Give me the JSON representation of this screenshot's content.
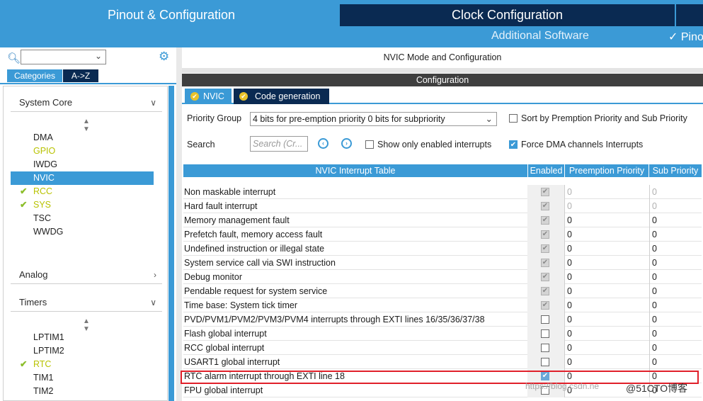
{
  "header": {
    "tab_pinout": "Pinout & Configuration",
    "tab_clock": "Clock Configuration",
    "additional_software": "Additional Software",
    "pinout_view": "✓ Pino"
  },
  "left": {
    "tab_categories": "Categories",
    "tab_az": "A->Z",
    "system_core": {
      "label": "System Core",
      "items": [
        {
          "label": "DMA",
          "state": "normal"
        },
        {
          "label": "GPIO",
          "state": "yellow"
        },
        {
          "label": "IWDG",
          "state": "normal"
        },
        {
          "label": "NVIC",
          "state": "selected"
        },
        {
          "label": "RCC",
          "state": "checked"
        },
        {
          "label": "SYS",
          "state": "checked"
        },
        {
          "label": "TSC",
          "state": "normal"
        },
        {
          "label": "WWDG",
          "state": "normal"
        }
      ]
    },
    "analog": {
      "label": "Analog"
    },
    "timers": {
      "label": "Timers",
      "items": [
        {
          "label": "LPTIM1",
          "state": "normal"
        },
        {
          "label": "LPTIM2",
          "state": "normal"
        },
        {
          "label": "RTC",
          "state": "checked"
        },
        {
          "label": "TIM1",
          "state": "normal"
        },
        {
          "label": "TIM2",
          "state": "normal"
        }
      ]
    }
  },
  "main": {
    "mode_title": "NVIC Mode and Configuration",
    "config_title": "Configuration",
    "tab_nvic": "NVIC",
    "tab_code_generation": "Code generation",
    "priority_group_label": "Priority Group",
    "priority_group_value": "4 bits for pre-emption priority 0 bits for subpriority",
    "sort_label": "Sort by Premption Priority and Sub Priority",
    "search_label": "Search",
    "search_placeholder": "Search (Cr...",
    "show_enabled_label": "Show only enabled interrupts",
    "force_dma_label": "Force DMA channels Interrupts",
    "force_dma_checked": true
  },
  "table": {
    "headers": [
      "NVIC Interrupt Table",
      "Enabled",
      "Preemption Priority",
      "Sub Priority"
    ],
    "rows": [
      {
        "name": "Non maskable interrupt",
        "enabled": "disabled-on",
        "pre": "0",
        "sub": "0",
        "grey": true
      },
      {
        "name": "Hard fault interrupt",
        "enabled": "disabled-on",
        "pre": "0",
        "sub": "0",
        "grey": true
      },
      {
        "name": "Memory management fault",
        "enabled": "disabled-on",
        "pre": "0",
        "sub": "0",
        "grey": false
      },
      {
        "name": "Prefetch fault, memory access fault",
        "enabled": "disabled-on",
        "pre": "0",
        "sub": "0",
        "grey": false
      },
      {
        "name": "Undefined instruction or illegal state",
        "enabled": "disabled-on",
        "pre": "0",
        "sub": "0",
        "grey": false
      },
      {
        "name": "System service call via SWI instruction",
        "enabled": "disabled-on",
        "pre": "0",
        "sub": "0",
        "grey": false
      },
      {
        "name": "Debug monitor",
        "enabled": "disabled-on",
        "pre": "0",
        "sub": "0",
        "grey": false
      },
      {
        "name": "Pendable request for system service",
        "enabled": "disabled-on",
        "pre": "0",
        "sub": "0",
        "grey": false
      },
      {
        "name": "Time base: System tick timer",
        "enabled": "disabled-on",
        "pre": "0",
        "sub": "0",
        "grey": false
      },
      {
        "name": "PVD/PVM1/PVM2/PVM3/PVM4 interrupts through EXTI lines 16/35/36/37/38",
        "enabled": "off",
        "pre": "0",
        "sub": "0",
        "grey": false
      },
      {
        "name": "Flash global interrupt",
        "enabled": "off",
        "pre": "0",
        "sub": "0",
        "grey": false
      },
      {
        "name": "RCC global interrupt",
        "enabled": "off",
        "pre": "0",
        "sub": "0",
        "grey": false
      },
      {
        "name": "USART1 global interrupt",
        "enabled": "off",
        "pre": "0",
        "sub": "0",
        "grey": false
      },
      {
        "name": "RTC alarm interrupt through EXTI line 18",
        "enabled": "on",
        "pre": "0",
        "sub": "0",
        "grey": false
      },
      {
        "name": "FPU global interrupt",
        "enabled": "off",
        "pre": "0",
        "sub": "0",
        "grey": false
      }
    ]
  },
  "watermark": {
    "text": "https://blog.csdn.ne",
    "brand": "@51CTO博客"
  }
}
